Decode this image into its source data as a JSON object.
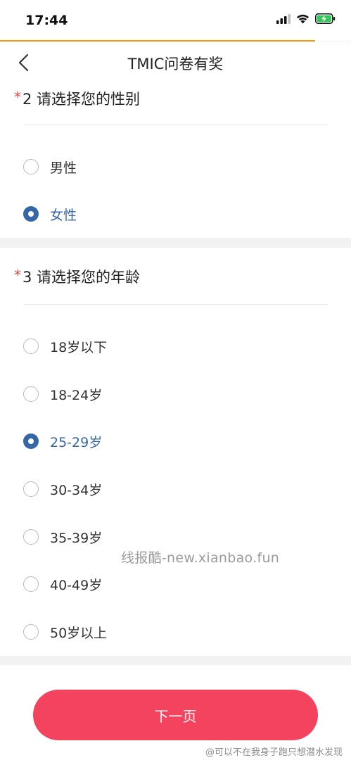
{
  "status_bar": {
    "time": "17:44",
    "icons": [
      "signal-icon",
      "wifi-icon",
      "battery-charging-icon"
    ]
  },
  "colors": {
    "accent": "#f39800",
    "selected": "#3567a8",
    "required": "#e64545",
    "button": "#f4435e"
  },
  "nav": {
    "back_icon": "chevron-left-icon",
    "title": "TMIC问卷有奖"
  },
  "questions": [
    {
      "required_mark": "*",
      "title": "2 请选择您的性别",
      "options": [
        {
          "label": "男性",
          "selected": false
        },
        {
          "label": "女性",
          "selected": true
        }
      ]
    },
    {
      "required_mark": "*",
      "title": "3 请选择您的年龄",
      "options": [
        {
          "label": "18岁以下",
          "selected": false
        },
        {
          "label": "18-24岁",
          "selected": false
        },
        {
          "label": "25-29岁",
          "selected": true
        },
        {
          "label": "30-34岁",
          "selected": false
        },
        {
          "label": "35-39岁",
          "selected": false
        },
        {
          "label": "40-49岁",
          "selected": false
        },
        {
          "label": "50岁以上",
          "selected": false
        }
      ]
    }
  ],
  "watermark": "线报酷-new.xianbao.fun",
  "next_button": {
    "label": "下一页"
  },
  "credit": "@可以不在我身子跑只想潜水发现"
}
